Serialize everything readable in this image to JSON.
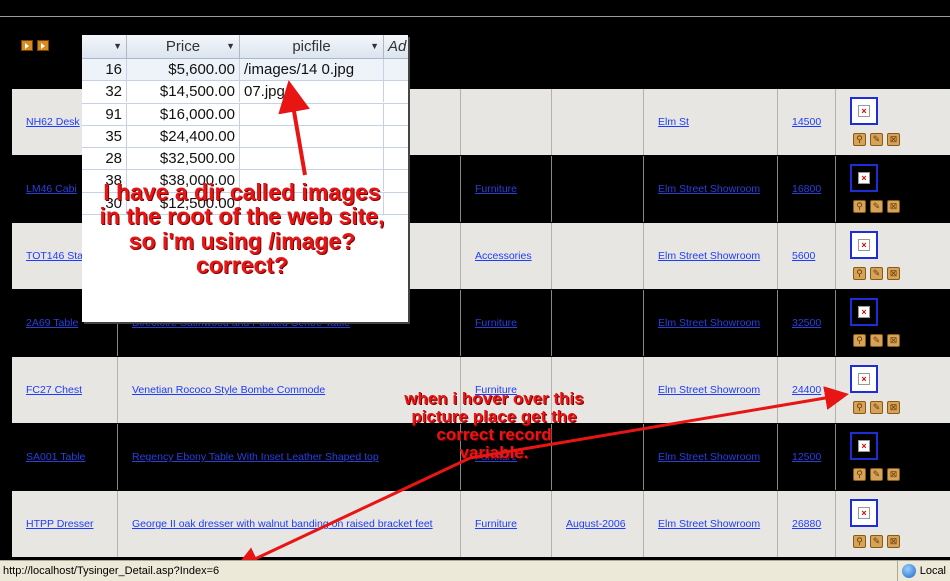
{
  "nav_icons": [
    "play-next-icon",
    "play-last-icon"
  ],
  "rows": [
    {
      "code": "NH62 Desk",
      "desc": "",
      "category": "",
      "date": "",
      "location": "Elm St",
      "price": "14500",
      "shade": "light"
    },
    {
      "code": "LM46 Cabi",
      "desc": "",
      "category": "Furniture",
      "date": "",
      "location": "Elm Street Showroom",
      "price": "16800",
      "shade": "dark"
    },
    {
      "code": "TOT146 Sta",
      "desc": "",
      "category": "Accessories",
      "date": "",
      "location": "Elm Street Showroom",
      "price": "5600",
      "shade": "light"
    },
    {
      "code": "2A69 Table",
      "desc": "Directoire Satinwood and Painted Centre Table",
      "category": "Furniture",
      "date": "",
      "location": "Elm Street Showroom",
      "price": "32500",
      "shade": "dark"
    },
    {
      "code": "FC27 Chest",
      "desc": "Venetian Rococo Style Bombe Commode",
      "category": "Furniture",
      "date": "",
      "location": "Elm Street Showroom",
      "price": "24400",
      "shade": "light"
    },
    {
      "code": "SA001 Table",
      "desc": "Regency Ebony Table With Inset Leather Shaped top",
      "category": "Furniture",
      "date": "",
      "location": "Elm Street Showroom",
      "price": "12500",
      "shade": "dark"
    },
    {
      "code": "HTPP Dresser",
      "desc": "George II oak dresser with walnut banding on raised bracket feet",
      "category": "Furniture",
      "date": "August-2006",
      "location": "Elm Street Showroom",
      "price": "26880",
      "shade": "light"
    }
  ],
  "overlay": {
    "columns": [
      "",
      "Price",
      "picfile",
      "Ad"
    ],
    "rows": [
      {
        "id": "16",
        "price": "$5,600.00",
        "pic": "/images/14  0.jpg"
      },
      {
        "id": "32",
        "price": "$14,500.00",
        "pic": "07.jpg"
      },
      {
        "id": "91",
        "price": "$16,000.00",
        "pic": ""
      },
      {
        "id": "35",
        "price": "$24,400.00",
        "pic": ""
      },
      {
        "id": "28",
        "price": "$32,500.00",
        "pic": ""
      },
      {
        "id": "38",
        "price": "$38,000.00",
        "pic": ""
      },
      {
        "id": "30",
        "price": "$12,500.00",
        "pic": ""
      }
    ]
  },
  "notes": {
    "note1": "I have a dir called images\nin the root of the web site,\nso i'm using /image?\ncorrect?",
    "note2": "when i hover over this\npicture place get the\ncorrect record\nvariable."
  },
  "status": {
    "url": "http://localhost/Tysinger_Detail.asp?Index=6",
    "zone": "Local"
  },
  "colors": {
    "annotation": "#e81515",
    "link": "#1c3cff",
    "row_light": "#e8e6e2",
    "row_dark": "#000000"
  }
}
